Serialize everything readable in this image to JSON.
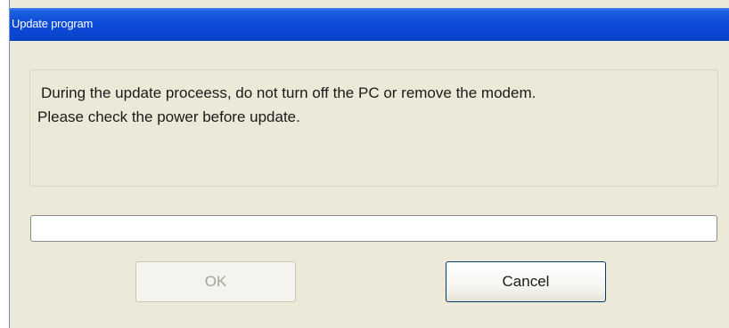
{
  "window": {
    "title": "Update program"
  },
  "message": {
    "line1": "During the update proceess, do not turn off the PC or remove the modem.",
    "line2": "Please check the power before update."
  },
  "progress": {
    "value": 0
  },
  "buttons": {
    "ok_label": "OK",
    "cancel_label": "Cancel"
  },
  "colors": {
    "titlebar": "#0a49d6",
    "dialog_bg": "#ece9d8"
  }
}
